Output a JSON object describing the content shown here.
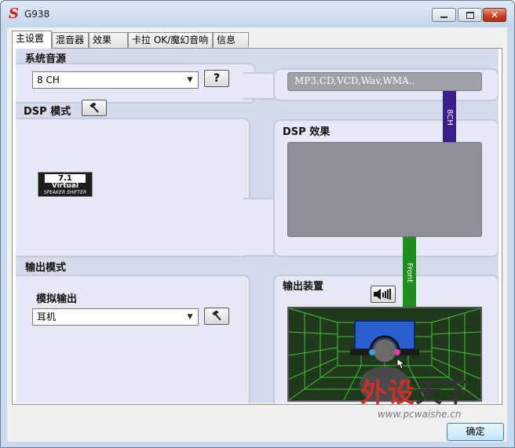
{
  "window": {
    "title": "G938",
    "app_icon": "S",
    "min_icon": "minimize-icon",
    "max_icon": "maximize-icon",
    "close_icon": "close-icon",
    "close_glyph": "✕"
  },
  "tabs": [
    {
      "label": "主设置",
      "active": true
    },
    {
      "label": "混音器",
      "active": false
    },
    {
      "label": "效果",
      "active": false
    },
    {
      "label": "卡拉 OK/魔幻音响",
      "active": false
    },
    {
      "label": "信息",
      "active": false
    }
  ],
  "source": {
    "label": "系统音源",
    "select_value": "8 CH",
    "help_label": "?",
    "formats_text": "MP3,CD,VCD,Wav,WMA.."
  },
  "dsp": {
    "mode_label": "DSP 模式",
    "effect_label": "DSP 效果",
    "settings_icon": "hammer-icon",
    "logo": {
      "line1": "7.1",
      "line2": "Virtual",
      "line3": "SPEAKER SHIFTER"
    }
  },
  "output": {
    "mode_label": "输出模式",
    "analog_label": "模拟输出",
    "select_value": "耳机",
    "device_label": "输出装置",
    "speaker_icon": "speaker-volume-icon"
  },
  "connectors": {
    "top_label": "8CH",
    "top_color": "#3a1f8a",
    "bottom_label": "Front",
    "bottom_color": "#1e8f1e"
  },
  "footer": {
    "ok_label": "确定"
  },
  "watermark": {
    "cn_red": "外设",
    "cn_black": "天下",
    "url": "www.pcwaishe.cn"
  }
}
